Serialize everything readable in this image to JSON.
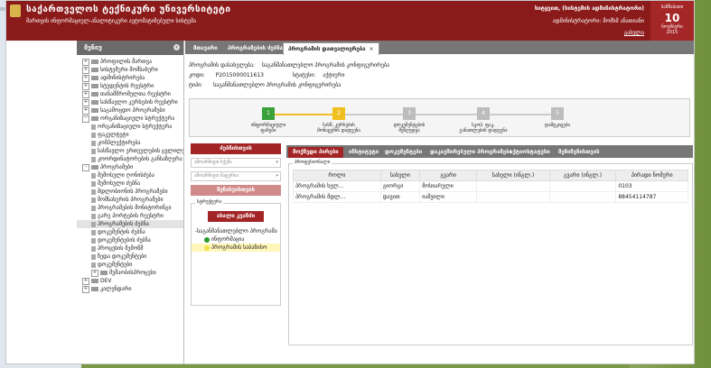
{
  "header": {
    "title": "საქართველოს ტექნიკური უნივერსიტეტი",
    "subtitle": "მართვის ინფორმაციულ-ანალიტიკური ავტომატიზებული სისტემა",
    "user": "სიტყვით, (სისტემის ადმინისტრატორი)",
    "role": "ადმინისტრატორი: მომხმ ანათიანი",
    "logout": "გასვლა",
    "date": {
      "weekday": "სამშაბათი",
      "day": "10",
      "month": "ნოემბერი",
      "year": "2015"
    }
  },
  "sidebar": {
    "title": "მენიუ",
    "items": [
      {
        "label": "პროფილის მართვა",
        "level": 0,
        "pm": "+",
        "type": "folder"
      },
      {
        "label": "სისტემური მომსახური",
        "level": 0,
        "pm": "+",
        "type": "folder"
      },
      {
        "label": "ადმინისტრირება",
        "level": 0,
        "pm": "+",
        "type": "folder"
      },
      {
        "label": "სტუდენტის რეესტრი",
        "level": 0,
        "pm": "+",
        "type": "folder"
      },
      {
        "label": "თანამშრომელთა რეესტრი",
        "level": 0,
        "pm": "+",
        "type": "folder"
      },
      {
        "label": "სასწავლო კურსების რეესტრი",
        "level": 0,
        "pm": "+",
        "type": "folder"
      },
      {
        "label": "საგამოცდო პროგრამები",
        "level": 0,
        "pm": "+",
        "type": "folder"
      },
      {
        "label": "ორგანიზაციული სტრუქტურა",
        "level": 0,
        "pm": "-",
        "type": "folder"
      },
      {
        "label": "ორგანიზაციული სტრუქტურა",
        "level": 1,
        "pm": "",
        "type": "doc"
      },
      {
        "label": "ფაკულტეტი",
        "level": 1,
        "pm": "",
        "type": "doc"
      },
      {
        "label": "კომპლექტირება",
        "level": 1,
        "pm": "",
        "type": "doc"
      },
      {
        "label": "სასწავლო ერთეულების ცვლილება",
        "level": 1,
        "pm": "",
        "type": "doc"
      },
      {
        "label": "კოორდინატორების განსაზღვრა",
        "level": 1,
        "pm": "",
        "type": "doc"
      },
      {
        "label": "პროგრამები",
        "level": 0,
        "pm": "-",
        "type": "folder"
      },
      {
        "label": "შემოსული ღონისძება",
        "level": 1,
        "pm": "",
        "type": "doc"
      },
      {
        "label": "შემოსული ძებნა",
        "level": 1,
        "pm": "",
        "type": "doc"
      },
      {
        "label": "მდლობიონის პროგრამები",
        "level": 1,
        "pm": "",
        "type": "doc"
      },
      {
        "label": "მომსახურის პროგრამები",
        "level": 1,
        "pm": "",
        "type": "doc"
      },
      {
        "label": "პროგრამების მონიტორინგი",
        "level": 1,
        "pm": "",
        "type": "doc"
      },
      {
        "label": "გარე პორტების რეესტრი",
        "level": 1,
        "pm": "",
        "type": "doc"
      },
      {
        "label": "პროგრამების ძებნა",
        "level": 1,
        "pm": "",
        "type": "doc",
        "selected": true
      },
      {
        "label": "დოკუმენტის ძებნა",
        "level": 1,
        "pm": "",
        "type": "doc"
      },
      {
        "label": "დოკუმენტების ძებნა",
        "level": 1,
        "pm": "",
        "type": "doc"
      },
      {
        "label": "პროცესის შემოწმ",
        "level": 1,
        "pm": "",
        "type": "doc"
      },
      {
        "label": "ზედა დოკუმენტები",
        "level": 1,
        "pm": "",
        "type": "doc"
      },
      {
        "label": "დოკუმენტები",
        "level": 1,
        "pm": "",
        "type": "doc"
      },
      {
        "label": "მუშაობისპროცესი",
        "level": 1,
        "pm": "+",
        "type": "folder"
      },
      {
        "label": "DEV",
        "level": 0,
        "pm": "+",
        "type": "folder"
      },
      {
        "label": "კალენდარი",
        "level": 0,
        "pm": "+",
        "type": "folder"
      }
    ]
  },
  "tabs": [
    {
      "label": "მთავარი",
      "active": false
    },
    {
      "label": "პროგრამების ძებნა",
      "active": false
    },
    {
      "label": "პროგრამის დათვალიერება",
      "active": true
    }
  ],
  "info": {
    "program_type_label": "პროგრამის დასახელება:",
    "program_type_value": "საგანმანათლებლო პროგრამის კონფიგურირება",
    "code_label": "კოდი:",
    "code_value": "P2015000011613",
    "status_label": "სტატუსი:",
    "status_value": "აქტიური",
    "type_label": "ტიპი:",
    "type_value": "საგანმანათლებლო პროგრამის კონფიგურირება"
  },
  "steps": [
    {
      "num": "1",
      "label": "ინფორმაციული ფაზები",
      "state": "done"
    },
    {
      "num": "2",
      "label": "სასწ. კურსების მონაცემის დადგენა",
      "state": "current"
    },
    {
      "num": "3",
      "label": "დოკუმენტების შეზღუდვა",
      "state": "pending"
    },
    {
      "num": "4",
      "label": "სკოპ. ფაკ. განათლების დადგენა",
      "state": "pending"
    },
    {
      "num": "5",
      "label": "დამტკიცება",
      "state": "pending"
    }
  ],
  "leftpanel": {
    "search_button": "ძებნისთვის",
    "select1": "ამოარჩიეთ სქემა",
    "select2": "ამოარჩიეთ მატერია",
    "filter_button": "შენახვისთვის",
    "group_legend": "სტრუქტურა",
    "new_node_button": "ახალი კვანძი",
    "nodes": [
      {
        "label": "საგანმანათლებლო პროგრამა",
        "kind": "folder",
        "level": 0
      },
      {
        "label": "ინფორმაცია",
        "kind": "green",
        "level": 1
      },
      {
        "label": "პროგრამის საბაზისო",
        "kind": "yellow",
        "level": 1
      }
    ]
  },
  "subtabs": [
    {
      "label": "მოქმედი პირები",
      "active": true
    },
    {
      "label": "ინსტიტუტი",
      "active": false
    },
    {
      "label": "დოკუმენტები",
      "active": false
    },
    {
      "label": "დაკავშირებული პროგრამები",
      "active": false
    },
    {
      "label": "აქტიოსტატუსი",
      "active": false
    },
    {
      "label": "შენიშვნისთვის",
      "active": false
    }
  ],
  "table": {
    "legend": "პროფესიონალი",
    "headers": [
      "როლი",
      "სახელი",
      "გვარი",
      "სახელი (ინგლ.)",
      "გვარი (ინგლ.)",
      "პირადი ნომერი"
    ],
    "rows": [
      [
        "პროგრამის ხელ...",
        "გიორგი",
        "მოსიარული",
        "",
        "",
        "0103"
      ],
      [
        "პროგრამის მდლ...",
        "დავით",
        "იაშვილი",
        "",
        "",
        "88454114787"
      ]
    ]
  }
}
